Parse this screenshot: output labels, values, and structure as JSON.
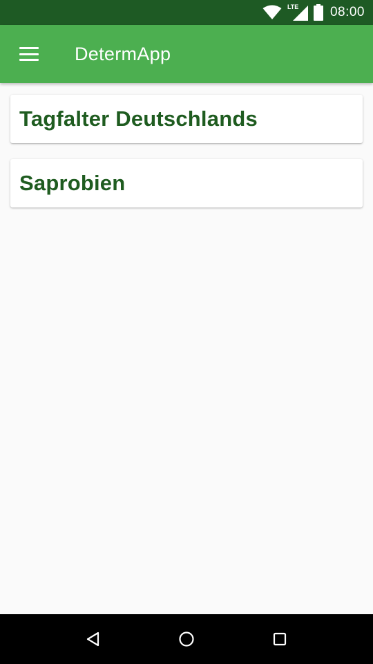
{
  "status_bar": {
    "network_label": "LTE",
    "time": "08:00",
    "icons": [
      "wifi-icon",
      "cell-signal-icon",
      "battery-icon"
    ]
  },
  "app_bar": {
    "menu_icon": "hamburger-menu-icon",
    "title": "DetermApp"
  },
  "cards": [
    {
      "title": "Tagfalter Deutschlands"
    },
    {
      "title": "Saprobien"
    }
  ],
  "nav_bar": {
    "icons": [
      "back-icon",
      "home-icon",
      "recents-icon"
    ]
  },
  "colors": {
    "status_bar": "#1e5a24",
    "app_bar": "#4caf50",
    "card_title": "#1f5c20",
    "background": "#fafafa",
    "nav_bar": "#000000"
  }
}
